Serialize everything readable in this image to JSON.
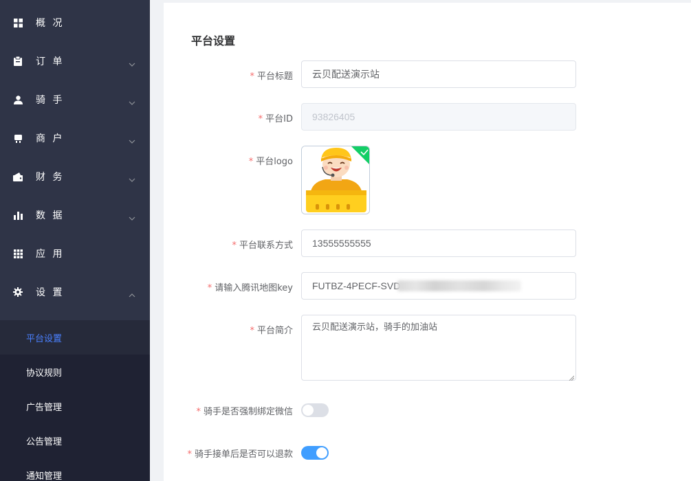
{
  "sidebar": {
    "menu": [
      {
        "label": "概 况",
        "icon": "dashboard-grid-icon",
        "has_arrow": false
      },
      {
        "label": "订 单",
        "icon": "clipboard-icon",
        "has_arrow": true
      },
      {
        "label": "骑 手",
        "icon": "user-icon",
        "has_arrow": true
      },
      {
        "label": "商 户",
        "icon": "shop-icon",
        "has_arrow": true
      },
      {
        "label": "财 务",
        "icon": "wallet-icon",
        "has_arrow": true
      },
      {
        "label": "数 据",
        "icon": "bar-chart-icon",
        "has_arrow": true
      },
      {
        "label": "应 用",
        "icon": "apps-grid-icon",
        "has_arrow": false
      },
      {
        "label": "设 置",
        "icon": "gear-icon",
        "has_arrow": true,
        "expanded": true
      }
    ],
    "submenu": [
      {
        "label": "平台设置",
        "active": true
      },
      {
        "label": "协议规则"
      },
      {
        "label": "广告管理"
      },
      {
        "label": "公告管理"
      },
      {
        "label": "通知管理"
      }
    ],
    "colors": {
      "background": "#2f3447",
      "active_text": "#4a80ff"
    }
  },
  "page": {
    "title": "平台设置",
    "required_mark": "*",
    "fields": {
      "title": {
        "label": "平台标题",
        "value": "云贝配送演示站"
      },
      "id": {
        "label": "平台ID",
        "placeholder": "93826405"
      },
      "logo": {
        "label": "平台logo",
        "uploaded": true
      },
      "contact": {
        "label": "平台联系方式",
        "value": "13555555555"
      },
      "map_key": {
        "label": "请输入腾讯地图key",
        "value": "FUTBZ-4PECF-SVD"
      },
      "intro": {
        "label": "平台简介",
        "value": "云贝配送演示站，骑手的加油站"
      },
      "force_wechat": {
        "label": "骑手是否强制绑定微信",
        "enabled": false
      },
      "refund_after_accept": {
        "label": "骑手接单后是否可以退款",
        "enabled": true
      }
    }
  },
  "colors": {
    "switch_on": "#409eff",
    "switch_off": "#dcdfe6",
    "required": "#f56c6c",
    "success_badge": "#13ce66"
  }
}
